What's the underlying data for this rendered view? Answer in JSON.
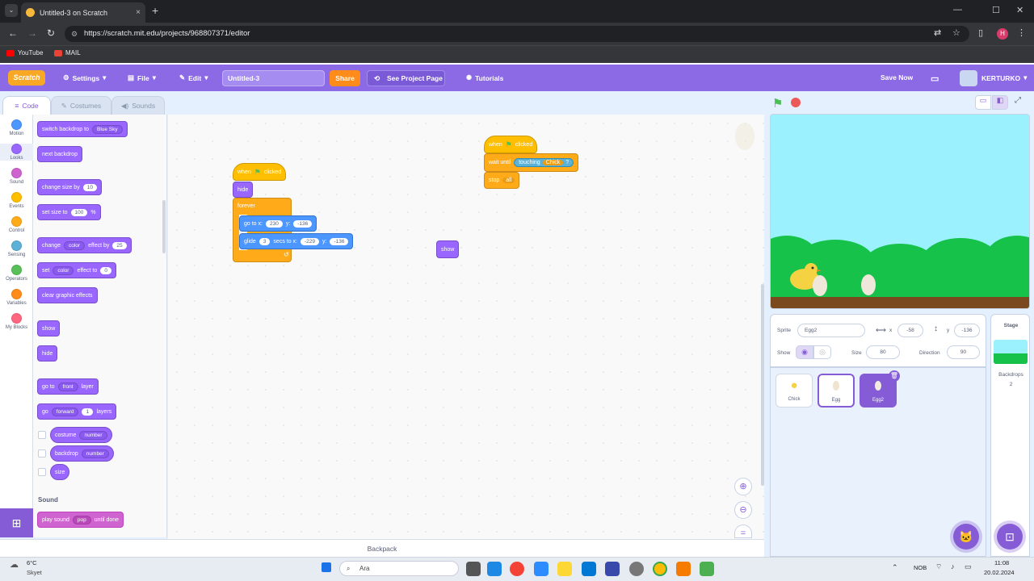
{
  "browser": {
    "tab_title": "Untitled-3 on Scratch",
    "tab_close": "×",
    "new_tab": "+",
    "tab_list": "⌄",
    "url": "https://scratch.mit.edu/projects/968807371/editor",
    "bookmarks": [
      "YouTube",
      "MAIL"
    ],
    "profile_initial": "H",
    "window_controls": [
      "—",
      "☐",
      "✕"
    ],
    "nav_icons": [
      "back-icon",
      "forward-icon",
      "reload-icon"
    ]
  },
  "menubar": {
    "logo": "Scratch",
    "settings": "Settings",
    "file": "File",
    "edit": "Edit",
    "project_title": "Untitled-3",
    "share": "Share",
    "see_project_page": "See Project Page",
    "tutorials": "Tutorials",
    "save_now": "Save Now",
    "username": "KERTURKO",
    "accent": "#8c6ae6"
  },
  "editor_tabs": [
    "Code",
    "Costumes",
    "Sounds"
  ],
  "categories": [
    {
      "label": "Motion",
      "color": "#4c97ff"
    },
    {
      "label": "Looks",
      "color": "#9966ff"
    },
    {
      "label": "Sound",
      "color": "#cf63cf"
    },
    {
      "label": "Events",
      "color": "#ffbf00"
    },
    {
      "label": "Control",
      "color": "#ffab19"
    },
    {
      "label": "Sensing",
      "color": "#5cb1d6"
    },
    {
      "label": "Operators",
      "color": "#59c059"
    },
    {
      "label": "Variables",
      "color": "#ff8c1a"
    },
    {
      "label": "My Blocks",
      "color": "#ff6680"
    }
  ],
  "palette": {
    "switch_backdrop": "switch backdrop to",
    "backdrop_value": "Blue Sky",
    "next_backdrop": "next backdrop",
    "change_size": "change size by",
    "change_size_val": "10",
    "set_size": "set size to",
    "set_size_val": "100",
    "percent": "%",
    "change_effect": "change",
    "effect_color": "color",
    "effect_by": "effect by",
    "effect_by_val": "25",
    "set_effect": "set",
    "effect_to": "effect to",
    "effect_to_val": "0",
    "clear_effects": "clear graphic effects",
    "show": "show",
    "hide": "hide",
    "go_to": "go to",
    "front": "front",
    "layer": "layer",
    "go": "go",
    "forward": "forward",
    "layers_val": "1",
    "layers": "layers",
    "costume": "costume",
    "backdrop": "backdrop",
    "number": "number",
    "size": "size",
    "sound_header": "Sound",
    "play_sound": "play sound",
    "pop": "pop",
    "until_done": "until done"
  },
  "scripts": {
    "when": "when",
    "clicked": "clicked",
    "hide": "hide",
    "forever": "forever",
    "go_to_x": "go to x:",
    "x_val": "230",
    "y_label": "y:",
    "y_val": "-136",
    "glide": "glide",
    "glide_secs": "3",
    "secs_to_x": "secs to x:",
    "glide_x": "-229",
    "glide_y": "-136",
    "loop_arrow": "↺",
    "wait_until": "wait until",
    "touching": "touching",
    "chick": "Chick",
    "question": "?",
    "stop": "stop",
    "all": "all",
    "show": "show"
  },
  "backpack": "Backpack",
  "sprite_info": {
    "sprite_label": "Sprite",
    "sprite_name": "Egg2",
    "x_label": "x",
    "x_val": "-58",
    "y_label": "y",
    "y_val": "-136",
    "show_label": "Show",
    "size_label": "Size",
    "size_val": "80",
    "direction_label": "Direction",
    "direction_val": "90"
  },
  "sprites": [
    "Chick",
    "Egg",
    "Egg2"
  ],
  "stage_panel": {
    "title": "Stage",
    "backdrops_label": "Backdrops",
    "backdrops_count": "2"
  },
  "taskbar": {
    "temp": "6°C",
    "weather": "Skyet",
    "search": "Ara",
    "lang": "NOB",
    "time": "11:08",
    "date": "20.02.2024"
  }
}
